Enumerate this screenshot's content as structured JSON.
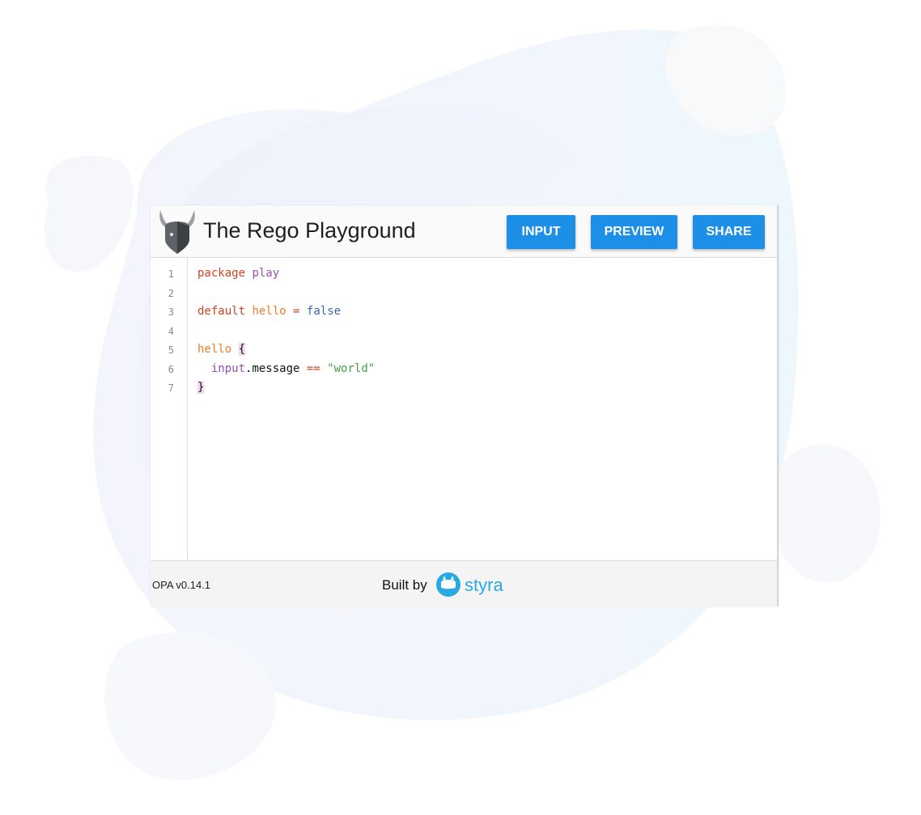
{
  "app": {
    "title": "The Rego Playground"
  },
  "toolbar": {
    "input_label": "INPUT",
    "preview_label": "PREVIEW",
    "share_label": "SHARE"
  },
  "editor": {
    "line_numbers": [
      "1",
      "2",
      "3",
      "4",
      "5",
      "6",
      "7"
    ],
    "lines": [
      [
        {
          "t": "package",
          "c": "kw-red"
        },
        {
          "t": " ",
          "c": "plain"
        },
        {
          "t": "play",
          "c": "kw-purple"
        }
      ],
      [],
      [
        {
          "t": "default",
          "c": "kw-red"
        },
        {
          "t": " ",
          "c": "plain"
        },
        {
          "t": "hello",
          "c": "kw-orange"
        },
        {
          "t": " ",
          "c": "plain"
        },
        {
          "t": "=",
          "c": "kw-red"
        },
        {
          "t": " ",
          "c": "plain"
        },
        {
          "t": "false",
          "c": "kw-blue"
        }
      ],
      [],
      [
        {
          "t": "hello",
          "c": "kw-orange"
        },
        {
          "t": " ",
          "c": "plain"
        },
        {
          "t": "{",
          "c": "brace"
        }
      ],
      [
        {
          "t": "  ",
          "c": "plain"
        },
        {
          "t": "input",
          "c": "kw-purple"
        },
        {
          "t": ".message",
          "c": "plain"
        },
        {
          "t": " ",
          "c": "plain"
        },
        {
          "t": "==",
          "c": "kw-red"
        },
        {
          "t": " ",
          "c": "plain"
        },
        {
          "t": "\"world\"",
          "c": "str-green"
        }
      ],
      [
        {
          "t": "}",
          "c": "brace"
        }
      ]
    ]
  },
  "footer": {
    "version": "OPA v0.14.1",
    "built_by": "Built by",
    "brand": "styra"
  },
  "colors": {
    "button": "#1e8fe6",
    "accent_brand": "#29a9e1"
  },
  "icons": {
    "logo": "opa-viking-helmet-icon",
    "brand_logo": "styra-logo-icon"
  }
}
